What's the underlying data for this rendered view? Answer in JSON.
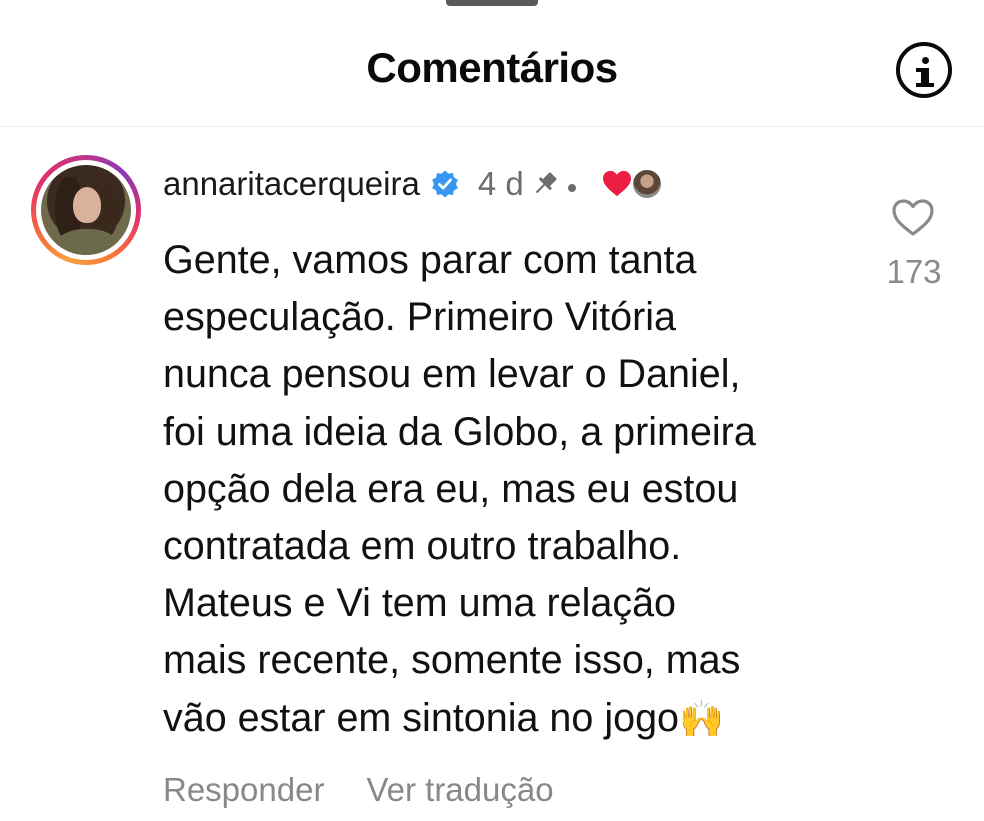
{
  "header": {
    "title": "Comentários"
  },
  "icons": {
    "info": "info-circle-icon",
    "verified": "verified-badge-icon",
    "pin": "pin-icon",
    "liked_by_author": "heart-filled-icon",
    "like": "heart-outline-icon"
  },
  "colors": {
    "verified": "#3797f0",
    "heart": "#ed1d42",
    "muted": "#888888"
  },
  "comment": {
    "username": "annaritacerqueira",
    "time": "4 d",
    "text": "Gente, vamos parar com tanta\nespeculação. Primeiro Vitória\nnunca pensou em levar o Daniel,\nfoi uma ideia da Globo, a primeira\nopção dela era eu, mas eu estou\ncontratada em outro trabalho.\nMateus e Vi tem uma relação\nmais recente, somente isso, mas\nvão estar em sintonia no jogo",
    "emoji": "🙌",
    "likes": "173",
    "reply_label": "Responder",
    "translate_label": "Ver tradução"
  }
}
